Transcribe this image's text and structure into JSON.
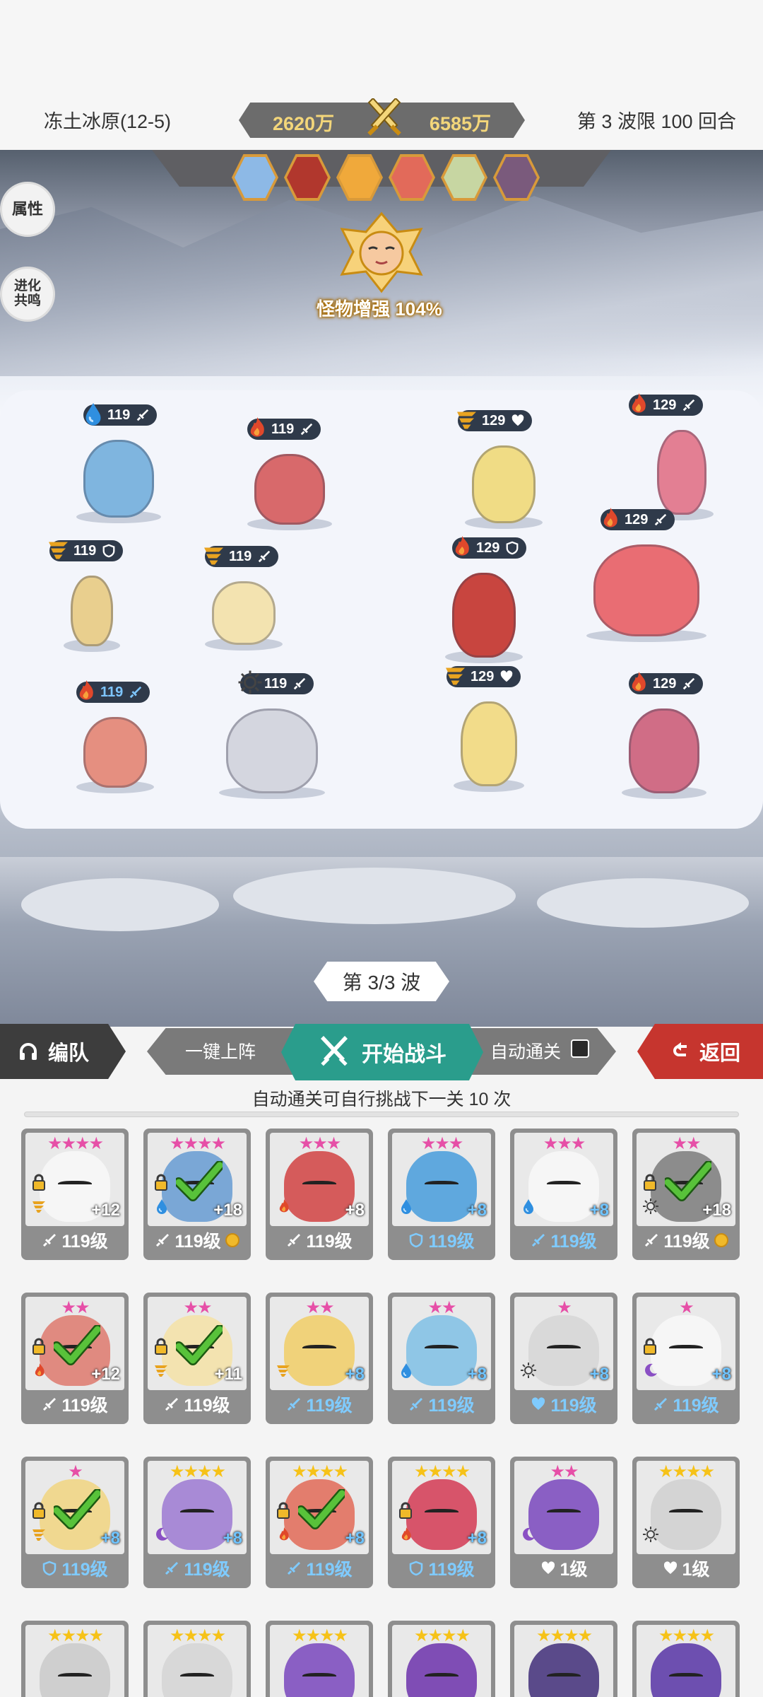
{
  "header": {
    "stage_name": "冻土冰原(12-5)",
    "our_power": "2620万",
    "enemy_power": "6585万",
    "wave_limit": "第 3 波限 100 回合"
  },
  "side_buttons": {
    "attributes": "属性",
    "evolution": "进化\n共鸣"
  },
  "boss_buff": "怪物增强 104%",
  "enemy_portrait_colors": [
    "#8db9e6",
    "#b1372d",
    "#f0a93b",
    "#e26a5a",
    "#c7d6a2",
    "#7a5a7c"
  ],
  "units": [
    {
      "level": "119",
      "element": "water",
      "position": "sword",
      "blue": false,
      "color": "#7fb5df"
    },
    {
      "level": "119",
      "element": "fire",
      "position": "sword",
      "blue": false,
      "color": "#d8696b"
    },
    {
      "level": "119",
      "element": "wind",
      "position": "shield",
      "blue": false,
      "color": "#e9cf8e"
    },
    {
      "level": "119",
      "element": "wind",
      "position": "sword",
      "blue": false,
      "color": "#f3e3b0"
    },
    {
      "level": "119",
      "element": "fire",
      "position": "sword",
      "blue": true,
      "color": "#e58f80"
    },
    {
      "level": "119",
      "element": "light",
      "position": "sword",
      "blue": false,
      "color": "#d4d6df"
    },
    {
      "level": "129",
      "element": "wind",
      "position": "heart",
      "blue": false,
      "color": "#f0dc85"
    },
    {
      "level": "129",
      "element": "fire",
      "position": "sword",
      "blue": false,
      "color": "#e37f93"
    },
    {
      "level": "129",
      "element": "fire",
      "position": "shield",
      "blue": false,
      "color": "#c8453f"
    },
    {
      "level": "129",
      "element": "fire",
      "position": "sword",
      "blue": false,
      "color": "#e96d73"
    },
    {
      "level": "129",
      "element": "wind",
      "position": "heart",
      "blue": false,
      "color": "#f2dc8a"
    },
    {
      "level": "129",
      "element": "fire",
      "position": "sword",
      "blue": false,
      "color": "#d06d86"
    }
  ],
  "wave_progress": "第 3/3 波",
  "actions": {
    "team": "编队",
    "one_click_deploy": "一键上阵",
    "start_battle": "开始战斗",
    "auto_clear": "自动通关",
    "back": "返回"
  },
  "auto_hint": "自动通关可自行挑战下一关 10 次",
  "roster": [
    {
      "stars": "★★★★",
      "star_color": "pink",
      "element": "wind",
      "plus": "+12",
      "plus_blue": false,
      "locked": true,
      "checked": false,
      "position": "sword",
      "level": "119级",
      "level_blue": false,
      "coin": false,
      "color": "#f6f6f6"
    },
    {
      "stars": "★★★★",
      "star_color": "pink",
      "element": "water",
      "plus": "+18",
      "plus_blue": false,
      "locked": true,
      "checked": true,
      "position": "sword",
      "level": "119级",
      "level_blue": false,
      "coin": true,
      "color": "#7aa7d6"
    },
    {
      "stars": "★★★",
      "star_color": "pink",
      "element": "fire",
      "plus": "+8",
      "plus_blue": false,
      "locked": false,
      "checked": false,
      "position": "sword",
      "level": "119级",
      "level_blue": false,
      "coin": false,
      "color": "#d55b5b"
    },
    {
      "stars": "★★★",
      "star_color": "pink",
      "element": "water",
      "plus": "+8",
      "plus_blue": true,
      "locked": false,
      "checked": false,
      "position": "shield",
      "level": "119级",
      "level_blue": true,
      "coin": false,
      "color": "#5fa8de"
    },
    {
      "stars": "★★★",
      "star_color": "pink",
      "element": "water",
      "plus": "+8",
      "plus_blue": true,
      "locked": false,
      "checked": false,
      "position": "sword",
      "level": "119级",
      "level_blue": true,
      "coin": false,
      "color": "#f6f6f6"
    },
    {
      "stars": "★★",
      "star_color": "pink",
      "element": "light",
      "plus": "+18",
      "plus_blue": false,
      "locked": true,
      "checked": true,
      "position": "sword",
      "level": "119级",
      "level_blue": false,
      "coin": true,
      "color": "#8c8c8c"
    },
    {
      "stars": "★★",
      "star_color": "pink",
      "element": "fire",
      "plus": "+12",
      "plus_blue": false,
      "locked": true,
      "checked": true,
      "position": "sword",
      "level": "119级",
      "level_blue": false,
      "coin": false,
      "color": "#e08a80"
    },
    {
      "stars": "★★",
      "star_color": "pink",
      "element": "wind",
      "plus": "+11",
      "plus_blue": false,
      "locked": true,
      "checked": true,
      "position": "sword",
      "level": "119级",
      "level_blue": false,
      "coin": false,
      "color": "#f3e3b0"
    },
    {
      "stars": "★★",
      "star_color": "pink",
      "element": "wind",
      "plus": "+8",
      "plus_blue": true,
      "locked": false,
      "checked": false,
      "position": "sword",
      "level": "119级",
      "level_blue": true,
      "coin": false,
      "color": "#f0d27a"
    },
    {
      "stars": "★★",
      "star_color": "pink",
      "element": "water",
      "plus": "+8",
      "plus_blue": true,
      "locked": false,
      "checked": false,
      "position": "sword",
      "level": "119级",
      "level_blue": true,
      "coin": false,
      "color": "#8fc6e6"
    },
    {
      "stars": "★",
      "star_color": "pink",
      "element": "light",
      "plus": "+8",
      "plus_blue": true,
      "locked": false,
      "checked": false,
      "position": "heart",
      "level": "119级",
      "level_blue": true,
      "coin": false,
      "color": "#d9d9d9"
    },
    {
      "stars": "★",
      "star_color": "pink",
      "element": "dark",
      "plus": "+8",
      "plus_blue": true,
      "locked": true,
      "checked": false,
      "position": "sword",
      "level": "119级",
      "level_blue": true,
      "coin": false,
      "color": "#f6f6f6"
    },
    {
      "stars": "★",
      "star_color": "pink",
      "element": "wind",
      "plus": "+8",
      "plus_blue": true,
      "locked": true,
      "checked": true,
      "position": "shield",
      "level": "119级",
      "level_blue": true,
      "coin": false,
      "color": "#f0d890"
    },
    {
      "stars": "★★★★",
      "star_color": "gold",
      "element": "dark",
      "plus": "+8",
      "plus_blue": true,
      "locked": false,
      "checked": false,
      "position": "sword",
      "level": "119级",
      "level_blue": true,
      "coin": false,
      "color": "#a88ad6"
    },
    {
      "stars": "★★★★",
      "star_color": "gold",
      "element": "fire",
      "plus": "+8",
      "plus_blue": true,
      "locked": true,
      "checked": true,
      "position": "sword",
      "level": "119级",
      "level_blue": true,
      "coin": false,
      "color": "#e37d6d"
    },
    {
      "stars": "★★★★",
      "star_color": "gold",
      "element": "fire",
      "plus": "+8",
      "plus_blue": true,
      "locked": true,
      "checked": false,
      "position": "shield",
      "level": "119级",
      "level_blue": true,
      "coin": false,
      "color": "#d7546a"
    },
    {
      "stars": "★★",
      "star_color": "pink",
      "element": "dark",
      "plus": "",
      "plus_blue": false,
      "locked": false,
      "checked": false,
      "position": "heart",
      "level": "1级",
      "level_blue": false,
      "coin": false,
      "color": "#8a5fc4"
    },
    {
      "stars": "★★★★",
      "star_color": "gold",
      "element": "light",
      "plus": "",
      "plus_blue": false,
      "locked": false,
      "checked": false,
      "position": "heart",
      "level": "1级",
      "level_blue": false,
      "coin": false,
      "color": "#d4d4d4"
    },
    {
      "stars": "★★★★",
      "star_color": "gold",
      "element": "",
      "plus": "",
      "plus_blue": false,
      "locked": false,
      "checked": false,
      "position": "",
      "level": "",
      "level_blue": false,
      "coin": false,
      "color": "#cfcfcf"
    },
    {
      "stars": "★★★★",
      "star_color": "gold",
      "element": "",
      "plus": "",
      "plus_blue": false,
      "locked": false,
      "checked": false,
      "position": "",
      "level": "",
      "level_blue": false,
      "coin": false,
      "color": "#d8d8d8"
    },
    {
      "stars": "★★★★",
      "star_color": "gold",
      "element": "",
      "plus": "",
      "plus_blue": false,
      "locked": false,
      "checked": false,
      "position": "",
      "level": "",
      "level_blue": false,
      "coin": false,
      "color": "#8a5fc4"
    },
    {
      "stars": "★★★★",
      "star_color": "gold",
      "element": "",
      "plus": "",
      "plus_blue": false,
      "locked": false,
      "checked": false,
      "position": "",
      "level": "",
      "level_blue": false,
      "coin": false,
      "color": "#7f4db5"
    },
    {
      "stars": "★★★★",
      "star_color": "gold",
      "element": "",
      "plus": "",
      "plus_blue": false,
      "locked": false,
      "checked": false,
      "position": "",
      "level": "",
      "level_blue": false,
      "coin": false,
      "color": "#5a4a8a"
    },
    {
      "stars": "★★★★",
      "star_color": "gold",
      "element": "",
      "plus": "",
      "plus_blue": false,
      "locked": false,
      "checked": false,
      "position": "",
      "level": "",
      "level_blue": false,
      "coin": false,
      "color": "#6d4fb0"
    }
  ]
}
